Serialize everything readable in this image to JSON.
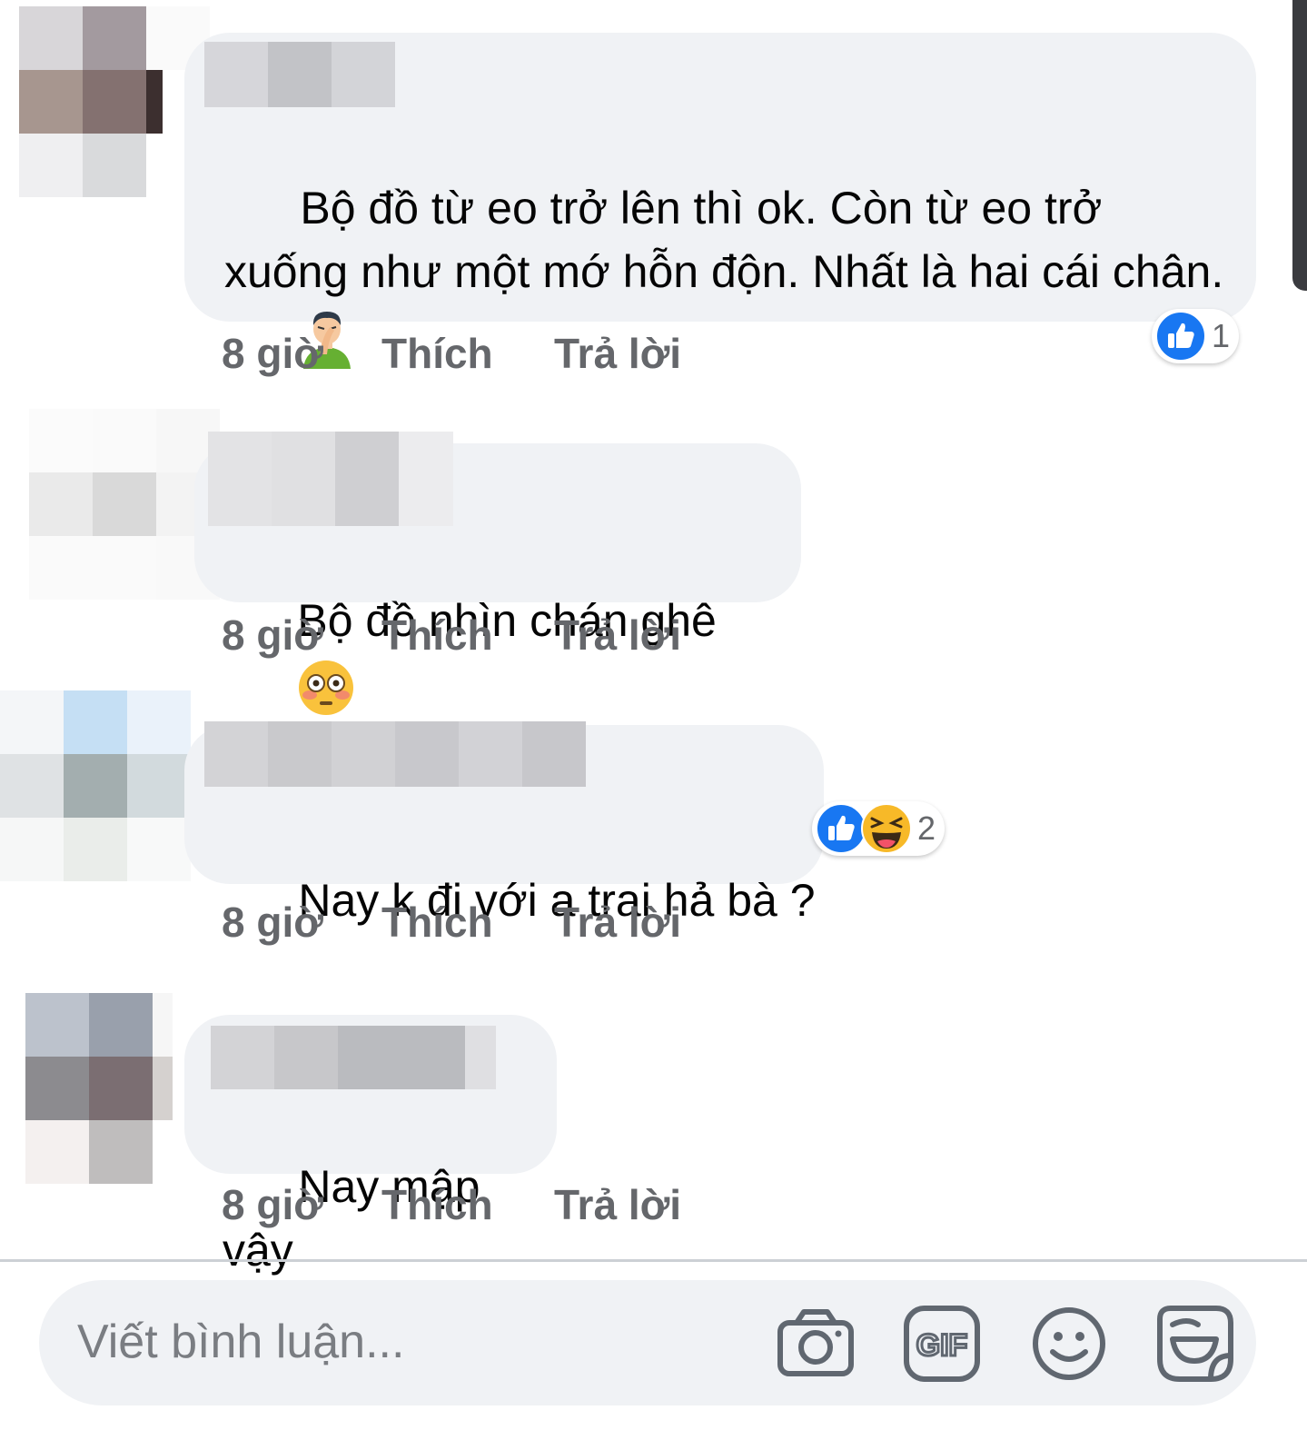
{
  "comments": [
    {
      "text": "Bộ đồ từ eo trở lên thì ok. Còn từ eo trở xuống như một mớ hỗn độn. Nhất là hai cái chân.",
      "emoji": "facepalm-emoji",
      "time": "8 giờ",
      "like_label": "Thích",
      "reply_label": "Trả lời",
      "reactions": {
        "icons": [
          "like"
        ],
        "count": "1"
      }
    },
    {
      "text": "Bộ đồ nhìn chán ghê",
      "emoji": "flushed-face-emoji",
      "time": "8 giờ",
      "like_label": "Thích",
      "reply_label": "Trả lời"
    },
    {
      "text": "Nay k đi với a trai hả bà ?",
      "time": "8 giờ",
      "like_label": "Thích",
      "reply_label": "Trả lời",
      "reactions": {
        "icons": [
          "like",
          "haha"
        ],
        "count": "2"
      }
    },
    {
      "text": "Nay mập vậy",
      "time": "8 giờ",
      "like_label": "Thích",
      "reply_label": "Trả lời"
    }
  ],
  "composer": {
    "placeholder": "Viết bình luận...",
    "tools": [
      "camera-icon",
      "gif-icon",
      "emoji-icon",
      "sticker-icon"
    ]
  },
  "colors": {
    "bubble": "#f0f2f5",
    "meta_text": "#65676b",
    "like_blue": "#1877f2",
    "haha_yellow": "#f7b928"
  }
}
